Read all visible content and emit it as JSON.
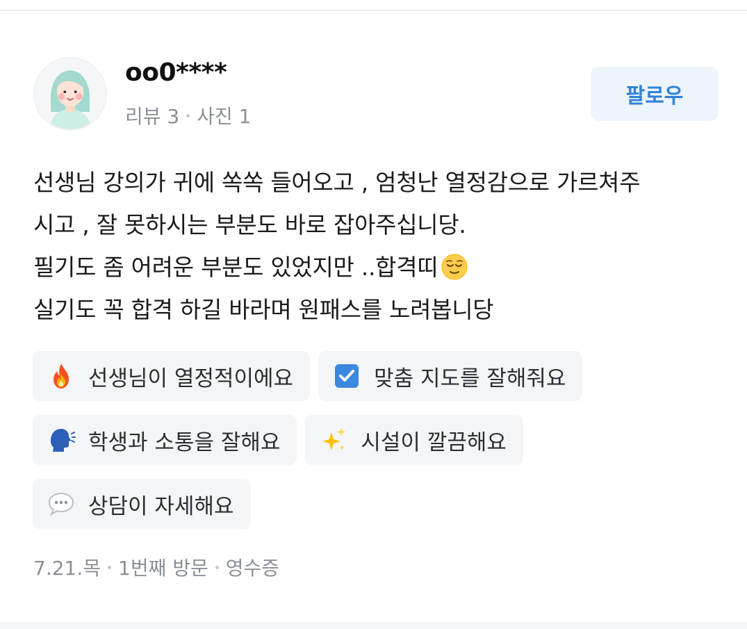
{
  "user": {
    "name": "oo0****",
    "reviews": "리뷰 3",
    "photos": "사진 1",
    "follow_label": "팔로우"
  },
  "review": {
    "lines": [
      "선생님 강의가 귀에 쏙쏙 들어오고 , 엄청난 열정감으로 가르쳐주",
      "시고 , 잘 못하시는 부분도 바로 잡아주십니당.",
      "필기도 좀 어려운 부분도 있었지만 ..합격띠",
      "실기도 꼭 합격 하길 바라며 원패스를 노려봅니당"
    ],
    "inline_emoji": "relieved-face-icon"
  },
  "tags": [
    {
      "icon": "fire-icon",
      "label": "선생님이 열정적이에요"
    },
    {
      "icon": "check-box-icon",
      "label": "맞춤 지도를 잘해줘요"
    },
    {
      "icon": "speaking-head-icon",
      "label": "학생과 소통을 잘해요"
    },
    {
      "icon": "sparkles-icon",
      "label": "시설이 깔끔해요"
    },
    {
      "icon": "speech-balloon-icon",
      "label": "상담이 자세해요"
    }
  ],
  "meta": {
    "date": "7.21.목",
    "visit": "1번째 방문",
    "verification": "영수증"
  },
  "colors": {
    "accent": "#3182d8",
    "follow_bg": "#edf4fc",
    "tag_bg": "#f3f5f7",
    "muted_text": "#8a8f96"
  }
}
